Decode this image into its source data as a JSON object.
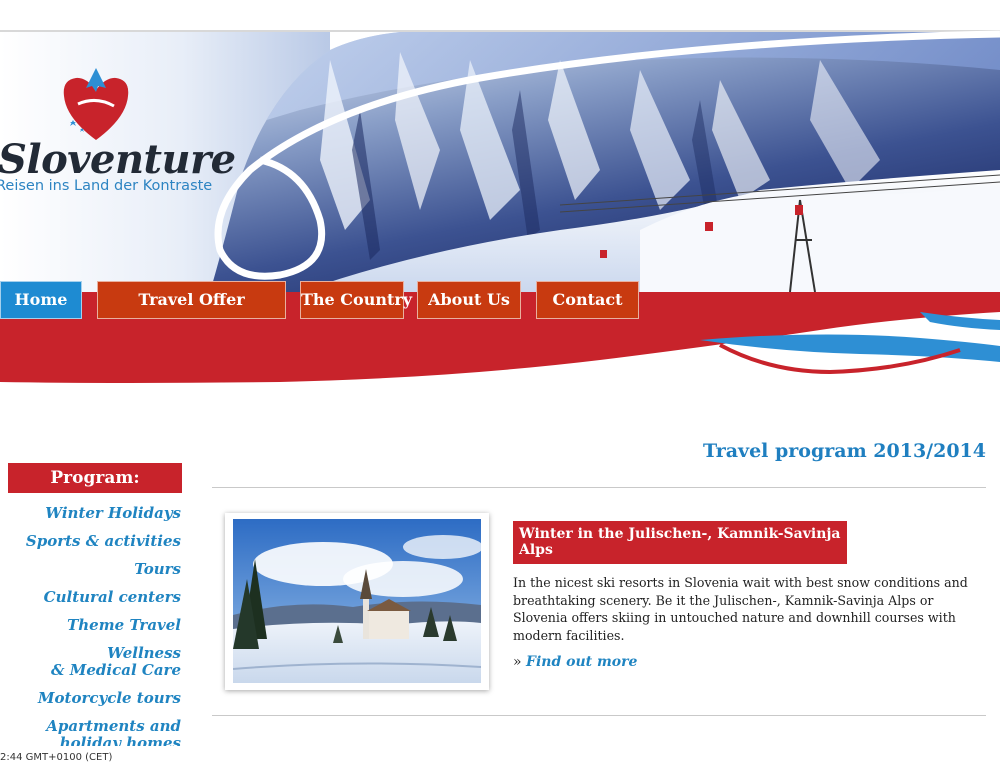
{
  "brand": {
    "name": "Sloventure",
    "tagline": "Reisen ins Land der Kontraste"
  },
  "nav": [
    {
      "label": "Home",
      "active": true
    },
    {
      "label": "Travel Offer",
      "active": false
    },
    {
      "label": "The Country",
      "active": false
    },
    {
      "label": "About Us",
      "active": false
    },
    {
      "label": "Contact",
      "active": false
    }
  ],
  "sidebar": {
    "title": "Program:",
    "items": [
      {
        "label": "Winter Holidays"
      },
      {
        "label": "Sports & activities"
      },
      {
        "label": "Tours"
      },
      {
        "label": "Cultural centers"
      },
      {
        "label": "Theme Travel"
      },
      {
        "label": "Wellness\n& Medical Care"
      },
      {
        "label": "Motorcycle tours"
      },
      {
        "label": "Apartments and\nholiday homes"
      }
    ]
  },
  "main": {
    "title": "Travel program 2013/2014",
    "article": {
      "heading": "Winter in the Julischen-, Kamnik-Savinja Alps",
      "body": "In the nicest ski resorts in Slovenia wait with best snow conditions and breathtaking scenery. Be it the Julischen-, Kamnik-Savinja Alps or Slovenia offers skiing in untouched nature and downhill courses with modern facilities.",
      "more_prefix": "»",
      "more_label": "Find out more"
    }
  },
  "status": {
    "text": "2:44 GMT+0100 (CET)"
  },
  "colors": {
    "brand_red": "#c8232b",
    "nav_red": "#c83a10",
    "nav_blue": "#1e8bd2",
    "link_blue": "#1f84c1"
  }
}
